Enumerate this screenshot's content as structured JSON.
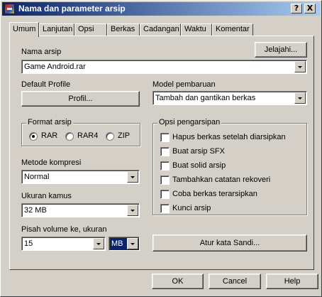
{
  "window": {
    "title": "Nama dan parameter arsip",
    "help_label": "?",
    "close_label": "X"
  },
  "tabs": [
    {
      "label": "Umum"
    },
    {
      "label": "Lanjutan"
    },
    {
      "label": "Opsi"
    },
    {
      "label": "Berkas"
    },
    {
      "label": "Cadangan"
    },
    {
      "label": "Waktu"
    },
    {
      "label": "Komentar"
    }
  ],
  "archive": {
    "name_label": "Nama arsip",
    "browse_label": "Jelajahi...",
    "name_value": "Game Android.rar"
  },
  "profile": {
    "label": "Default Profile",
    "button_label": "Profil..."
  },
  "update_mode": {
    "label": "Model pembaruan",
    "value": "Tambah dan gantikan berkas"
  },
  "format": {
    "title": "Format arsip",
    "options": [
      {
        "label": "RAR",
        "checked": true
      },
      {
        "label": "RAR4",
        "checked": false
      },
      {
        "label": "ZIP",
        "checked": false
      }
    ]
  },
  "compression": {
    "label": "Metode kompresi",
    "value": "Normal"
  },
  "dictionary": {
    "label": "Ukuran kamus",
    "value": "32 MB"
  },
  "volume": {
    "label": "Pisah volume ke, ukuran",
    "value": "15",
    "unit": "MB"
  },
  "archiving_options": {
    "title": "Opsi pengarsipan",
    "items": [
      {
        "label": "Hapus berkas setelah diarsipkan",
        "checked": false
      },
      {
        "label": "Buat arsip SFX",
        "checked": false
      },
      {
        "label": "Buat solid arsip",
        "checked": false
      },
      {
        "label": "Tambahkan catatan rekoveri",
        "checked": false
      },
      {
        "label": "Coba berkas terarsipkan",
        "checked": false
      },
      {
        "label": "Kunci arsip",
        "checked": false
      }
    ]
  },
  "password_button_label": "Atur kata Sandi...",
  "footer": {
    "ok_label": "OK",
    "cancel_label": "Cancel",
    "help_label": "Help"
  }
}
